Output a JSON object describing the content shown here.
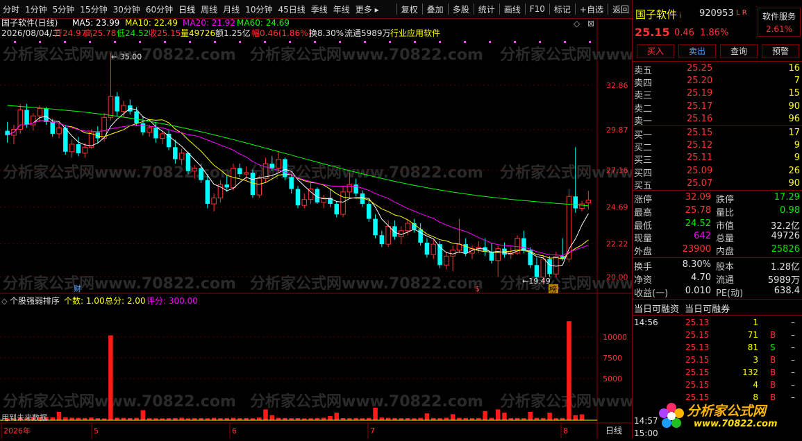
{
  "toolbar": {
    "left_items": [
      "分时",
      "1分钟",
      "5分钟",
      "15分钟",
      "30分钟",
      "60分钟",
      "日线",
      "周线",
      "月线",
      "10分钟",
      "45日线",
      "季线",
      "年线",
      "更多 ▸"
    ],
    "right_items": [
      "复权",
      "叠加",
      "多股",
      "统计",
      "画线",
      "F10",
      "标记",
      "+自选",
      "返回"
    ]
  },
  "chart_header": {
    "stock_title": "国子软件(日线)",
    "ma5": "MA5: 23.99",
    "ma10": "MA10: 22.49",
    "ma20": "MA20: 21.92",
    "ma60": "MA60: 24.69",
    "date": "2026/08/04/二",
    "open": "开24.97",
    "high": "高25.78",
    "low": "低24.52",
    "close": "收25.15",
    "volume": "量49726",
    "amount": "额1.25亿",
    "amplitude": "幅0.46(1.86%)",
    "turnover": "换8.30%",
    "float": "流通5989万",
    "industry": "行业应用软件"
  },
  "price_axis": [
    "32.86",
    "29.87",
    "27.16",
    "24.69",
    "22.22",
    "20.00"
  ],
  "price_annotations": {
    "high_label": "35.00",
    "low_label": "19.49",
    "marker_cai": "财",
    "marker_s": "$",
    "marker_bang": "榜"
  },
  "indicator": {
    "name": "个股强弱排序",
    "count_label": "个数: 1.00",
    "total_label": "总分: 2.00",
    "score_label": "评分: 300.00",
    "axis": [
      "10000",
      "7500",
      "5000"
    ],
    "note": "用到未来数据"
  },
  "time_axis": {
    "labels": [
      "2026年",
      "5",
      "6",
      "7",
      "8"
    ],
    "period": "日线"
  },
  "watermark": "分析家公式网www.70822.com",
  "chart_data": {
    "type": "candlestick",
    "ylim": [
      19.0,
      35.5
    ],
    "y_ticks": [
      32.86,
      29.87,
      27.16,
      24.69,
      22.22,
      20.0
    ],
    "series": [
      {
        "name": "MA5",
        "color": "#ffffff"
      },
      {
        "name": "MA10",
        "color": "#ffff00"
      },
      {
        "name": "MA20",
        "color": "#ff00ff"
      },
      {
        "name": "MA60",
        "color": "#00ff00"
      }
    ],
    "candles": [
      [
        29.8,
        30.4,
        29.0,
        29.5
      ],
      [
        29.5,
        30.2,
        28.9,
        29.9
      ],
      [
        29.9,
        31.6,
        29.6,
        31.2
      ],
      [
        31.2,
        31.6,
        30.0,
        30.2
      ],
      [
        30.2,
        31.0,
        29.8,
        30.8
      ],
      [
        30.8,
        31.5,
        30.4,
        31.3
      ],
      [
        31.3,
        31.4,
        30.2,
        30.4
      ],
      [
        30.4,
        30.6,
        29.4,
        29.6
      ],
      [
        29.6,
        30.3,
        29.3,
        30.0
      ],
      [
        30.0,
        30.2,
        28.2,
        28.4
      ],
      [
        28.4,
        29.2,
        28.0,
        28.9
      ],
      [
        28.9,
        29.4,
        28.1,
        28.3
      ],
      [
        28.3,
        29.0,
        28.0,
        28.7
      ],
      [
        28.7,
        29.9,
        28.6,
        29.7
      ],
      [
        29.7,
        30.1,
        29.0,
        29.3
      ],
      [
        29.3,
        31.0,
        29.1,
        30.7
      ],
      [
        30.7,
        35.0,
        30.5,
        32.1
      ],
      [
        32.1,
        32.4,
        30.8,
        31.1
      ],
      [
        31.1,
        31.8,
        30.7,
        31.5
      ],
      [
        31.5,
        31.9,
        30.9,
        31.1
      ],
      [
        31.1,
        31.4,
        30.1,
        30.3
      ],
      [
        30.3,
        30.8,
        29.5,
        29.7
      ],
      [
        29.7,
        30.2,
        29.4,
        30.0
      ],
      [
        30.0,
        30.4,
        29.0,
        29.3
      ],
      [
        29.3,
        29.8,
        28.9,
        29.6
      ],
      [
        29.6,
        29.9,
        28.5,
        28.7
      ],
      [
        28.7,
        29.2,
        27.6,
        27.9
      ],
      [
        27.9,
        28.6,
        27.5,
        28.3
      ],
      [
        28.3,
        28.4,
        26.9,
        27.1
      ],
      [
        27.1,
        27.5,
        26.6,
        27.3
      ],
      [
        27.3,
        27.6,
        26.3,
        26.5
      ],
      [
        26.5,
        26.9,
        24.6,
        24.9
      ],
      [
        24.9,
        25.6,
        24.4,
        25.3
      ],
      [
        25.3,
        26.5,
        25.0,
        26.2
      ],
      [
        26.2,
        26.8,
        25.7,
        26.0
      ],
      [
        26.0,
        27.6,
        25.8,
        27.3
      ],
      [
        27.3,
        27.6,
        26.7,
        26.9
      ],
      [
        26.9,
        27.4,
        26.5,
        27.0
      ],
      [
        27.0,
        27.2,
        25.3,
        25.5
      ],
      [
        25.5,
        26.8,
        25.3,
        26.6
      ],
      [
        26.6,
        28.0,
        26.3,
        27.6
      ],
      [
        27.6,
        28.1,
        27.1,
        27.3
      ],
      [
        27.3,
        28.4,
        27.0,
        27.9
      ],
      [
        27.9,
        28.0,
        26.5,
        26.7
      ],
      [
        26.7,
        26.9,
        25.6,
        25.9
      ],
      [
        25.9,
        26.1,
        24.6,
        24.8
      ],
      [
        24.8,
        25.6,
        24.6,
        25.2
      ],
      [
        25.2,
        26.3,
        24.9,
        25.9
      ],
      [
        25.9,
        26.0,
        24.9,
        25.0
      ],
      [
        25.0,
        25.5,
        24.6,
        25.3
      ],
      [
        25.3,
        25.9,
        24.7,
        24.9
      ],
      [
        24.9,
        25.1,
        24.0,
        24.2
      ],
      [
        24.2,
        26.1,
        24.0,
        25.7
      ],
      [
        25.7,
        27.0,
        25.3,
        26.2
      ],
      [
        26.2,
        26.6,
        25.4,
        25.6
      ],
      [
        25.6,
        25.8,
        24.7,
        24.9
      ],
      [
        24.9,
        25.2,
        23.7,
        23.9
      ],
      [
        23.9,
        24.2,
        22.6,
        22.8
      ],
      [
        22.8,
        23.1,
        22.0,
        22.2
      ],
      [
        22.2,
        23.8,
        22.0,
        23.4
      ],
      [
        23.4,
        23.8,
        22.5,
        22.7
      ],
      [
        22.7,
        23.4,
        22.2,
        23.1
      ],
      [
        23.1,
        23.9,
        22.8,
        23.6
      ],
      [
        23.6,
        23.9,
        23.0,
        23.2
      ],
      [
        23.2,
        23.6,
        22.1,
        22.3
      ],
      [
        22.3,
        22.6,
        21.3,
        21.5
      ],
      [
        21.5,
        22.5,
        21.2,
        22.2
      ],
      [
        22.2,
        22.4,
        20.6,
        20.8
      ],
      [
        20.8,
        21.7,
        20.5,
        21.4
      ],
      [
        21.4,
        22.1,
        20.4,
        21.8
      ],
      [
        21.8,
        23.9,
        21.6,
        22.2
      ],
      [
        22.2,
        22.6,
        21.4,
        21.6
      ],
      [
        21.6,
        22.1,
        21.2,
        21.9
      ],
      [
        21.9,
        22.4,
        21.6,
        22.0
      ],
      [
        22.0,
        22.6,
        21.4,
        21.7
      ],
      [
        21.7,
        22.3,
        20.9,
        21.1
      ],
      [
        21.1,
        22.1,
        20.0,
        21.9
      ],
      [
        21.9,
        22.3,
        21.3,
        21.5
      ],
      [
        21.5,
        22.0,
        21.2,
        21.6
      ],
      [
        21.6,
        22.8,
        21.5,
        22.6
      ],
      [
        22.6,
        23.1,
        21.6,
        21.8
      ],
      [
        21.8,
        22.0,
        20.6,
        20.8
      ],
      [
        20.8,
        21.3,
        19.7,
        20.0
      ],
      [
        20.0,
        21.5,
        19.5,
        21.2
      ],
      [
        21.2,
        21.4,
        20.0,
        20.2
      ],
      [
        20.2,
        21.7,
        20.0,
        21.4
      ],
      [
        21.4,
        22.6,
        21.1,
        21.2
      ],
      [
        21.2,
        25.9,
        21.0,
        25.4
      ],
      [
        25.4,
        28.7,
        24.3,
        24.6
      ],
      [
        24.6,
        25.1,
        24.4,
        24.9
      ],
      [
        24.97,
        25.78,
        24.52,
        25.15
      ]
    ],
    "volume": [
      180,
      220,
      260,
      240,
      400,
      420,
      380,
      340,
      1000,
      360,
      300,
      280,
      260,
      320,
      240,
      210,
      10200,
      300,
      280,
      260,
      280,
      1200,
      240,
      230,
      220,
      240,
      260,
      300,
      220,
      240,
      250,
      230,
      280,
      240,
      250,
      290,
      240,
      260,
      230,
      320,
      1300,
      600,
      280,
      260,
      240,
      250,
      220,
      230,
      260,
      300,
      500,
      900,
      250,
      240,
      260,
      230,
      270,
      1500,
      320,
      280,
      260,
      240,
      250,
      230,
      280,
      820,
      260,
      240,
      300,
      720,
      280,
      260,
      240,
      260,
      1100,
      280,
      1300,
      900,
      250,
      260,
      240,
      1000,
      280,
      260,
      900,
      240,
      260,
      11900,
      600,
      700
    ]
  },
  "quote": {
    "name": "国子软件",
    "name_mark": "i",
    "code": "920953",
    "flags": "L R",
    "sector": "软件服务",
    "sector_pct": "2.61%",
    "price": "25.15",
    "change": "0.46",
    "change_pct": "1.86%",
    "buttons": [
      "买入",
      "卖出",
      "查询",
      "预警"
    ],
    "sell": [
      {
        "label": "卖五",
        "price": "25.25",
        "vol": "16"
      },
      {
        "label": "卖四",
        "price": "25.20",
        "vol": "7"
      },
      {
        "label": "卖三",
        "price": "25.19",
        "vol": "15"
      },
      {
        "label": "卖二",
        "price": "25.17",
        "vol": "90"
      },
      {
        "label": "卖一",
        "price": "25.16",
        "vol": "96"
      }
    ],
    "buy": [
      {
        "label": "买一",
        "price": "25.15",
        "vol": "17"
      },
      {
        "label": "买二",
        "price": "25.12",
        "vol": "9"
      },
      {
        "label": "买三",
        "price": "25.11",
        "vol": "9"
      },
      {
        "label": "买四",
        "price": "25.09",
        "vol": "26"
      },
      {
        "label": "买五",
        "price": "25.07",
        "vol": "90"
      }
    ],
    "stats": [
      {
        "l1": "涨停",
        "v1": "32.09",
        "c1": "red",
        "l2": "跌停",
        "v2": "17.29",
        "c2": "green"
      },
      {
        "l1": "最高",
        "v1": "25.78",
        "c1": "red",
        "l2": "量比",
        "v2": "0.98",
        "c2": "green"
      },
      {
        "l1": "最低",
        "v1": "24.52",
        "c1": "green",
        "l2": "市值",
        "v2": "32.2亿",
        "c2": "wht"
      },
      {
        "l1": "现量",
        "v1": "642",
        "c1": "mag",
        "l2": "总量",
        "v2": "49726",
        "c2": "wht"
      },
      {
        "l1": "外盘",
        "v1": "23900",
        "c1": "red",
        "l2": "内盘",
        "v2": "25826",
        "c2": "green"
      }
    ],
    "fin": [
      {
        "l1": "换手",
        "v1": "8.30%",
        "l2": "股本",
        "v2": "1.28亿"
      },
      {
        "l1": "净资",
        "v1": "4.70",
        "l2": "流通",
        "v2": "5989万"
      },
      {
        "l1": "收益(一)",
        "v1": "0.010",
        "l2": "PE(动)",
        "v2": "638.4"
      }
    ],
    "margin_tabs": [
      "当日可融资",
      "当日可融券"
    ],
    "ticks": [
      {
        "time": "14:56",
        "price": "25.13",
        "vol": "1",
        "bs": "",
        "dash": "–"
      },
      {
        "time": "",
        "price": "25.15",
        "vol": "71",
        "bs": "B",
        "dash": "–"
      },
      {
        "time": "",
        "price": "25.13",
        "vol": "81",
        "bs": "S",
        "dash": "–"
      },
      {
        "time": "",
        "price": "25.15",
        "vol": "3",
        "bs": "B",
        "dash": "–"
      },
      {
        "time": "",
        "price": "25.15",
        "vol": "132",
        "bs": "B",
        "dash": "–"
      },
      {
        "time": "",
        "price": "25.15",
        "vol": "4",
        "bs": "B",
        "dash": "–"
      },
      {
        "time": "",
        "price": "25.15",
        "vol": "8",
        "bs": "B",
        "dash": "–"
      }
    ],
    "tick_times_bottom": [
      "14:57",
      "15:00"
    ]
  },
  "logo": {
    "text": "分析家公式网",
    "url": "www.70822.com"
  }
}
